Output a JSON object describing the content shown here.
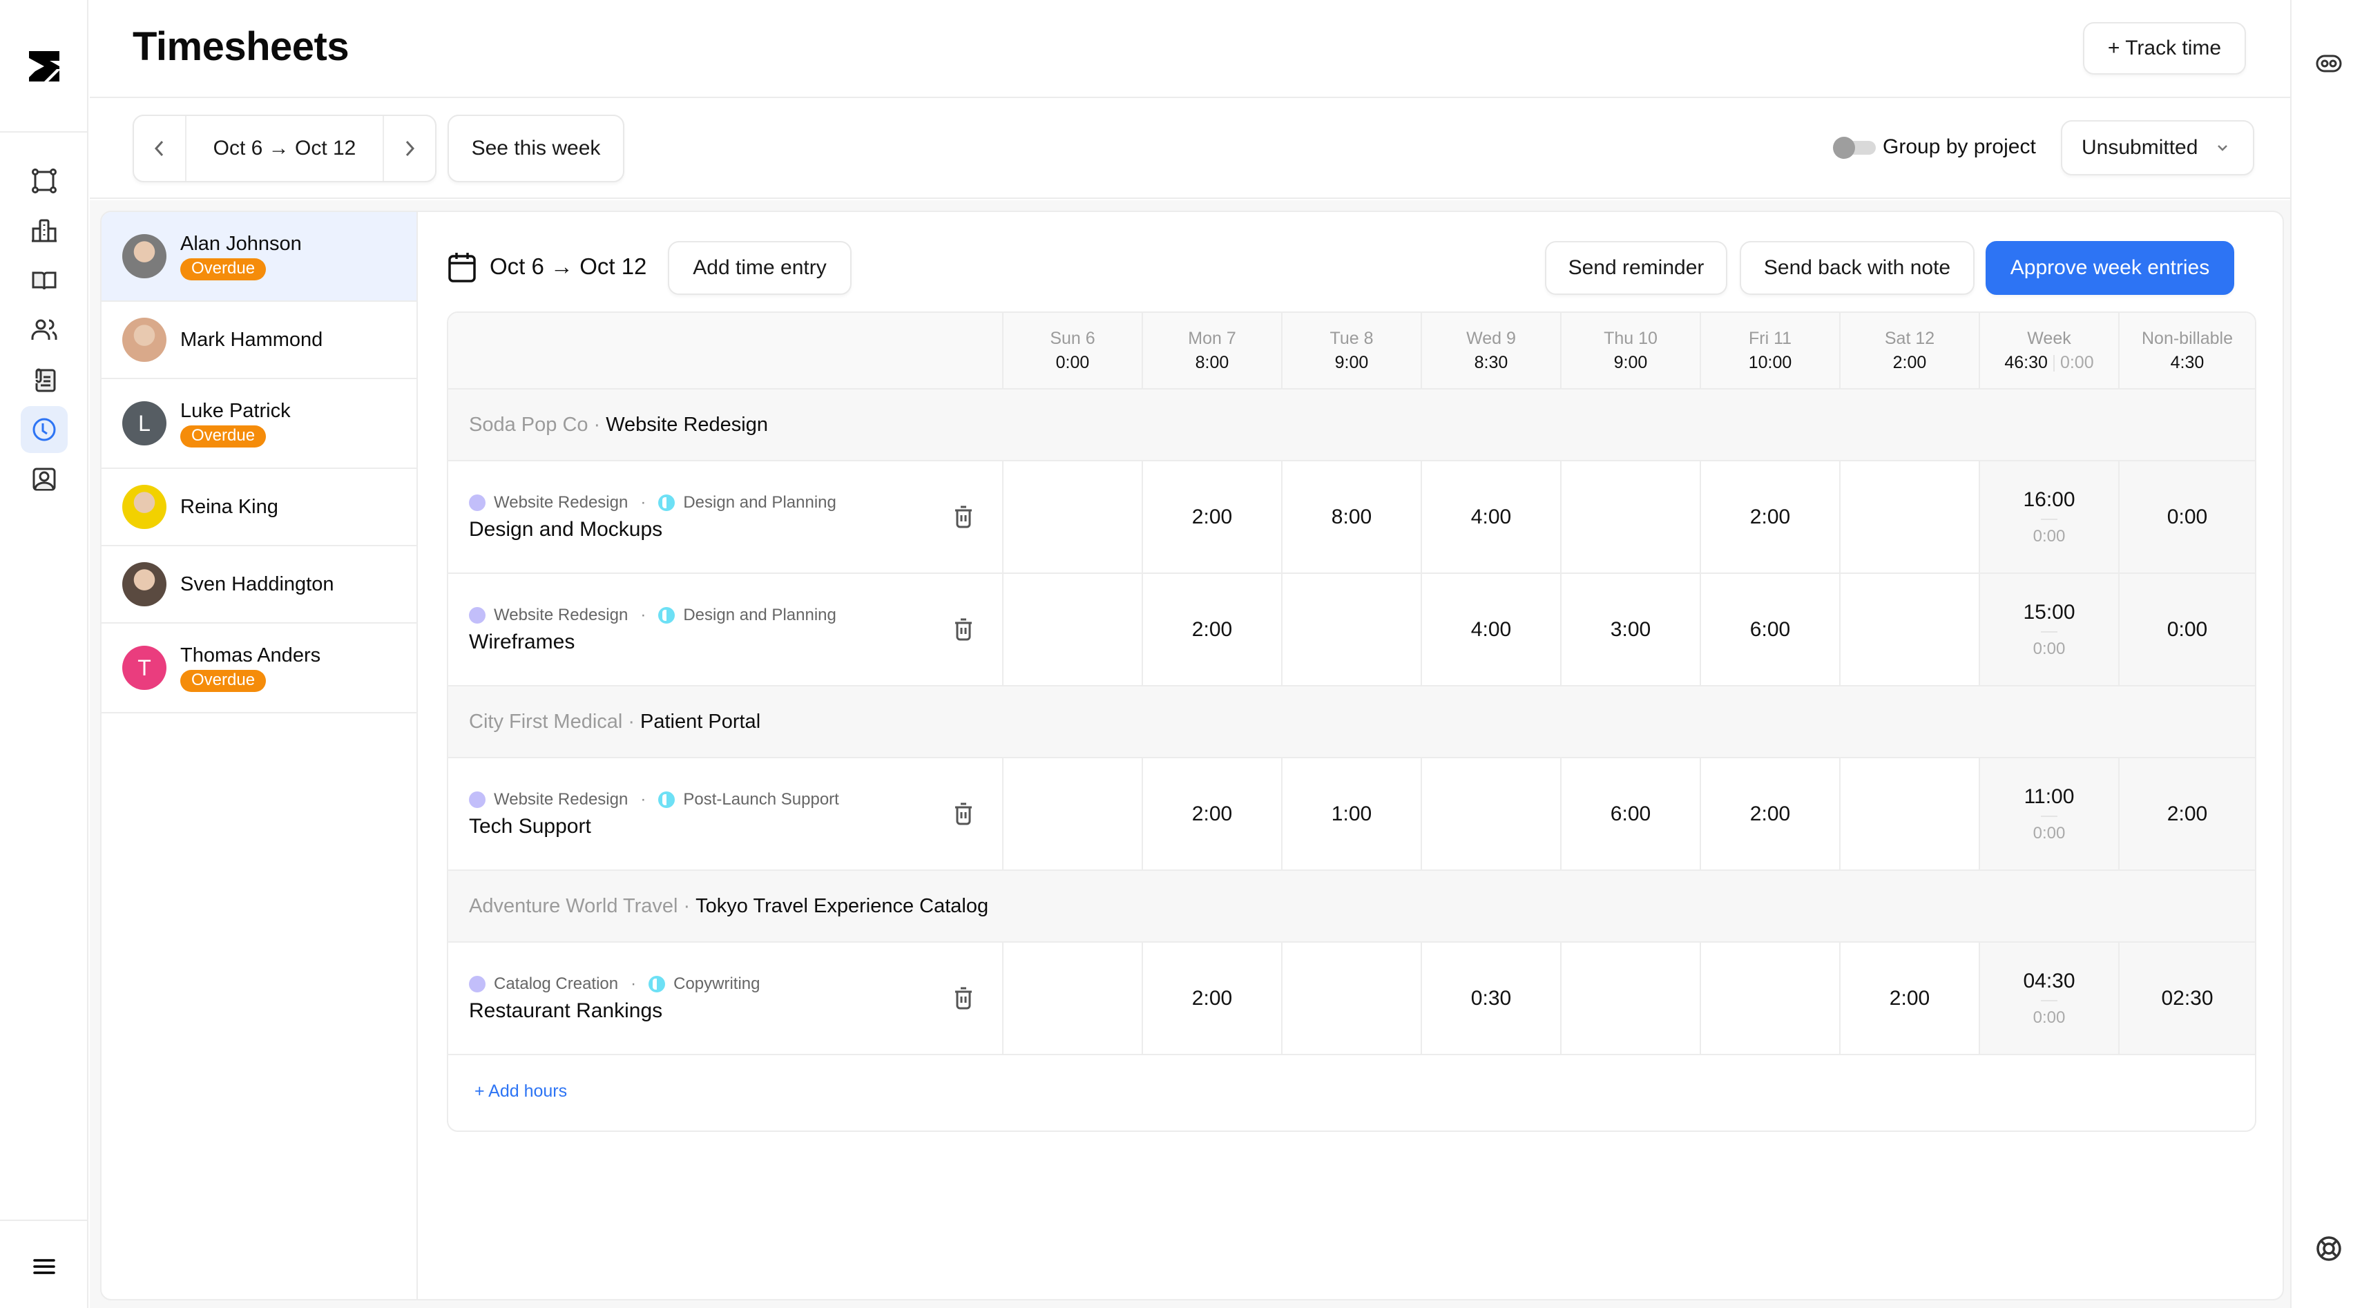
{
  "header": {
    "title": "Timesheets",
    "track_time_label": "+ Track time"
  },
  "toolbar": {
    "prev_label": "previous week",
    "week_range": "Oct 6 → Oct 12",
    "next_label": "next week",
    "see_this_week": "See this week",
    "group_by_project": "Group by project",
    "group_by_project_enabled": false,
    "status_filter": "Unsubmitted"
  },
  "left_rail": {
    "items": [
      {
        "icon": "frame-icon",
        "label": "Projects"
      },
      {
        "icon": "building-icon",
        "label": "Clients"
      },
      {
        "icon": "book-icon",
        "label": "Library"
      },
      {
        "icon": "users-icon",
        "label": "Team"
      },
      {
        "icon": "clipboard-icon",
        "label": "Invoices"
      },
      {
        "icon": "clock-icon",
        "label": "Timesheets",
        "active": true
      },
      {
        "icon": "contact-icon",
        "label": "Contacts"
      }
    ]
  },
  "employees": [
    {
      "name": "Alan Johnson",
      "badge": "Overdue",
      "selected": true,
      "avatar": "photo",
      "avatar_color": "#7b7b7b"
    },
    {
      "name": "Mark Hammond",
      "badge": null,
      "avatar": "photo",
      "avatar_color": "#d9a98a"
    },
    {
      "name": "Luke Patrick",
      "badge": "Overdue",
      "avatar": "L",
      "avatar_color": "#565d63"
    },
    {
      "name": "Reina King",
      "badge": null,
      "avatar": "photo",
      "avatar_color": "#f2d100"
    },
    {
      "name": "Sven Haddington",
      "badge": null,
      "avatar": "photo",
      "avatar_color": "#5a4a40"
    },
    {
      "name": "Thomas Anders",
      "badge": "Overdue",
      "avatar": "T",
      "avatar_color": "#ea3d7e"
    }
  ],
  "panel": {
    "week_range": "Oct 6 → Oct 12",
    "add_time_entry": "Add time entry",
    "send_reminder": "Send reminder",
    "send_back": "Send back with note",
    "approve": "Approve week entries",
    "add_hours": "+ Add hours"
  },
  "table": {
    "columns": [
      {
        "label": "Sun 6",
        "total": "0:00"
      },
      {
        "label": "Mon 7",
        "total": "8:00"
      },
      {
        "label": "Tue 8",
        "total": "9:00"
      },
      {
        "label": "Wed 9",
        "total": "8:30"
      },
      {
        "label": "Thu 10",
        "total": "9:00"
      },
      {
        "label": "Fri 11",
        "total": "10:00"
      },
      {
        "label": "Sat 12",
        "total": "2:00"
      }
    ],
    "week_header": {
      "label": "Week",
      "total": "46:30",
      "secondary": "0:00"
    },
    "nonbillable_header": {
      "label": "Non-billable",
      "total": "4:30"
    },
    "groups": [
      {
        "client": "Soda Pop Co",
        "project": "Website Redesign",
        "entries": [
          {
            "project_tag": "Website Redesign",
            "phase_tag": "Design and Planning",
            "task": "Design and Mockups",
            "days": [
              "",
              "2:00",
              "8:00",
              "4:00",
              "",
              "2:00",
              ""
            ],
            "week": "16:00",
            "week_secondary": "0:00",
            "nonbillable": "0:00"
          },
          {
            "project_tag": "Website Redesign",
            "phase_tag": "Design and Planning",
            "task": "Wireframes",
            "days": [
              "",
              "2:00",
              "",
              "4:00",
              "3:00",
              "6:00",
              ""
            ],
            "week": "15:00",
            "week_secondary": "0:00",
            "nonbillable": "0:00"
          }
        ]
      },
      {
        "client": "City First Medical",
        "project": "Patient Portal",
        "entries": [
          {
            "project_tag": "Website Redesign",
            "phase_tag": "Post-Launch Support",
            "task": "Tech Support",
            "days": [
              "",
              "2:00",
              "1:00",
              "",
              "6:00",
              "2:00",
              ""
            ],
            "week": "11:00",
            "week_secondary": "0:00",
            "nonbillable": "2:00"
          }
        ]
      },
      {
        "client": "Adventure World Travel",
        "project": "Tokyo Travel Experience Catalog",
        "entries": [
          {
            "project_tag": "Catalog Creation",
            "phase_tag": "Copywriting",
            "task": "Restaurant Rankings",
            "days": [
              "",
              "2:00",
              "",
              "0:30",
              "",
              "",
              "2:00"
            ],
            "week": "04:30",
            "week_secondary": "0:00",
            "nonbillable": "02:30"
          }
        ]
      }
    ]
  },
  "colors": {
    "accent": "#2d74f4",
    "overdue": "#f58c0a",
    "project_dot": "#c2befa",
    "phase_dot": "#6de0f5",
    "active_nav_bg": "#e6eefc"
  }
}
